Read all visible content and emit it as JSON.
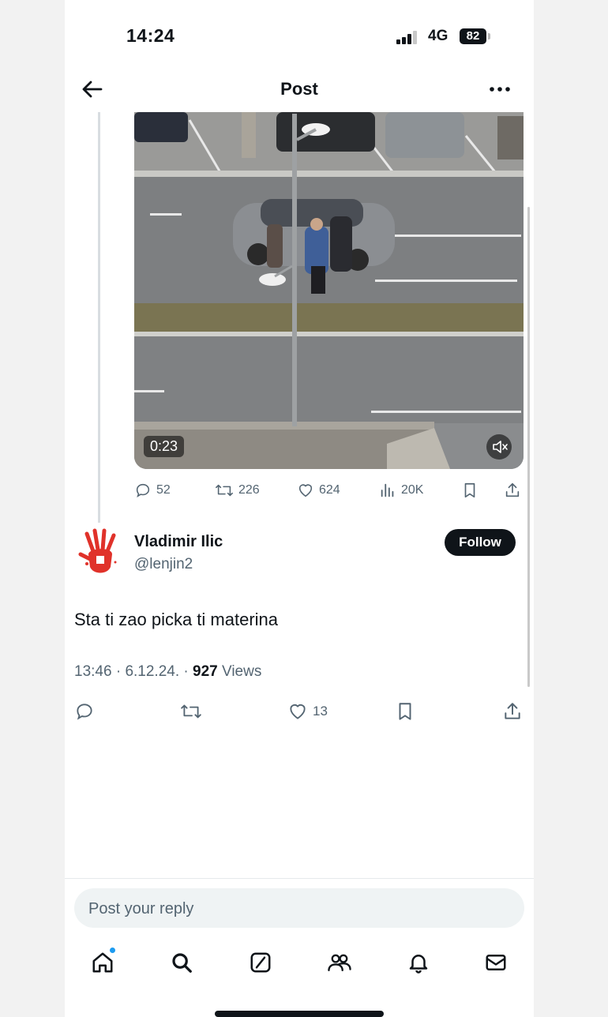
{
  "status_bar": {
    "time": "14:24",
    "network": "4G",
    "battery": "82"
  },
  "header": {
    "title": "Post"
  },
  "video": {
    "duration": "0:23"
  },
  "quoted_stats": {
    "replies": "52",
    "reposts": "226",
    "likes": "624",
    "views": "20K"
  },
  "reply": {
    "author_name": "Vladimir Ilic",
    "author_handle": "@lenjin2",
    "follow_label": "Follow",
    "text": "Sta ti zao picka ti materina",
    "time": "13:46",
    "date": "6.12.24.",
    "views_count": "927",
    "views_label": "Views",
    "likes": "13"
  },
  "composer": {
    "placeholder": "Post your reply"
  },
  "nav": {
    "items": [
      "home-icon",
      "search-icon",
      "grok-icon",
      "communities-icon",
      "notifications-icon",
      "messages-icon"
    ],
    "home_has_badge": true
  },
  "colors": {
    "text": "#0f1419",
    "secondary": "#536471",
    "accent": "#1d9bf0",
    "reply_bg": "#eff3f4"
  }
}
